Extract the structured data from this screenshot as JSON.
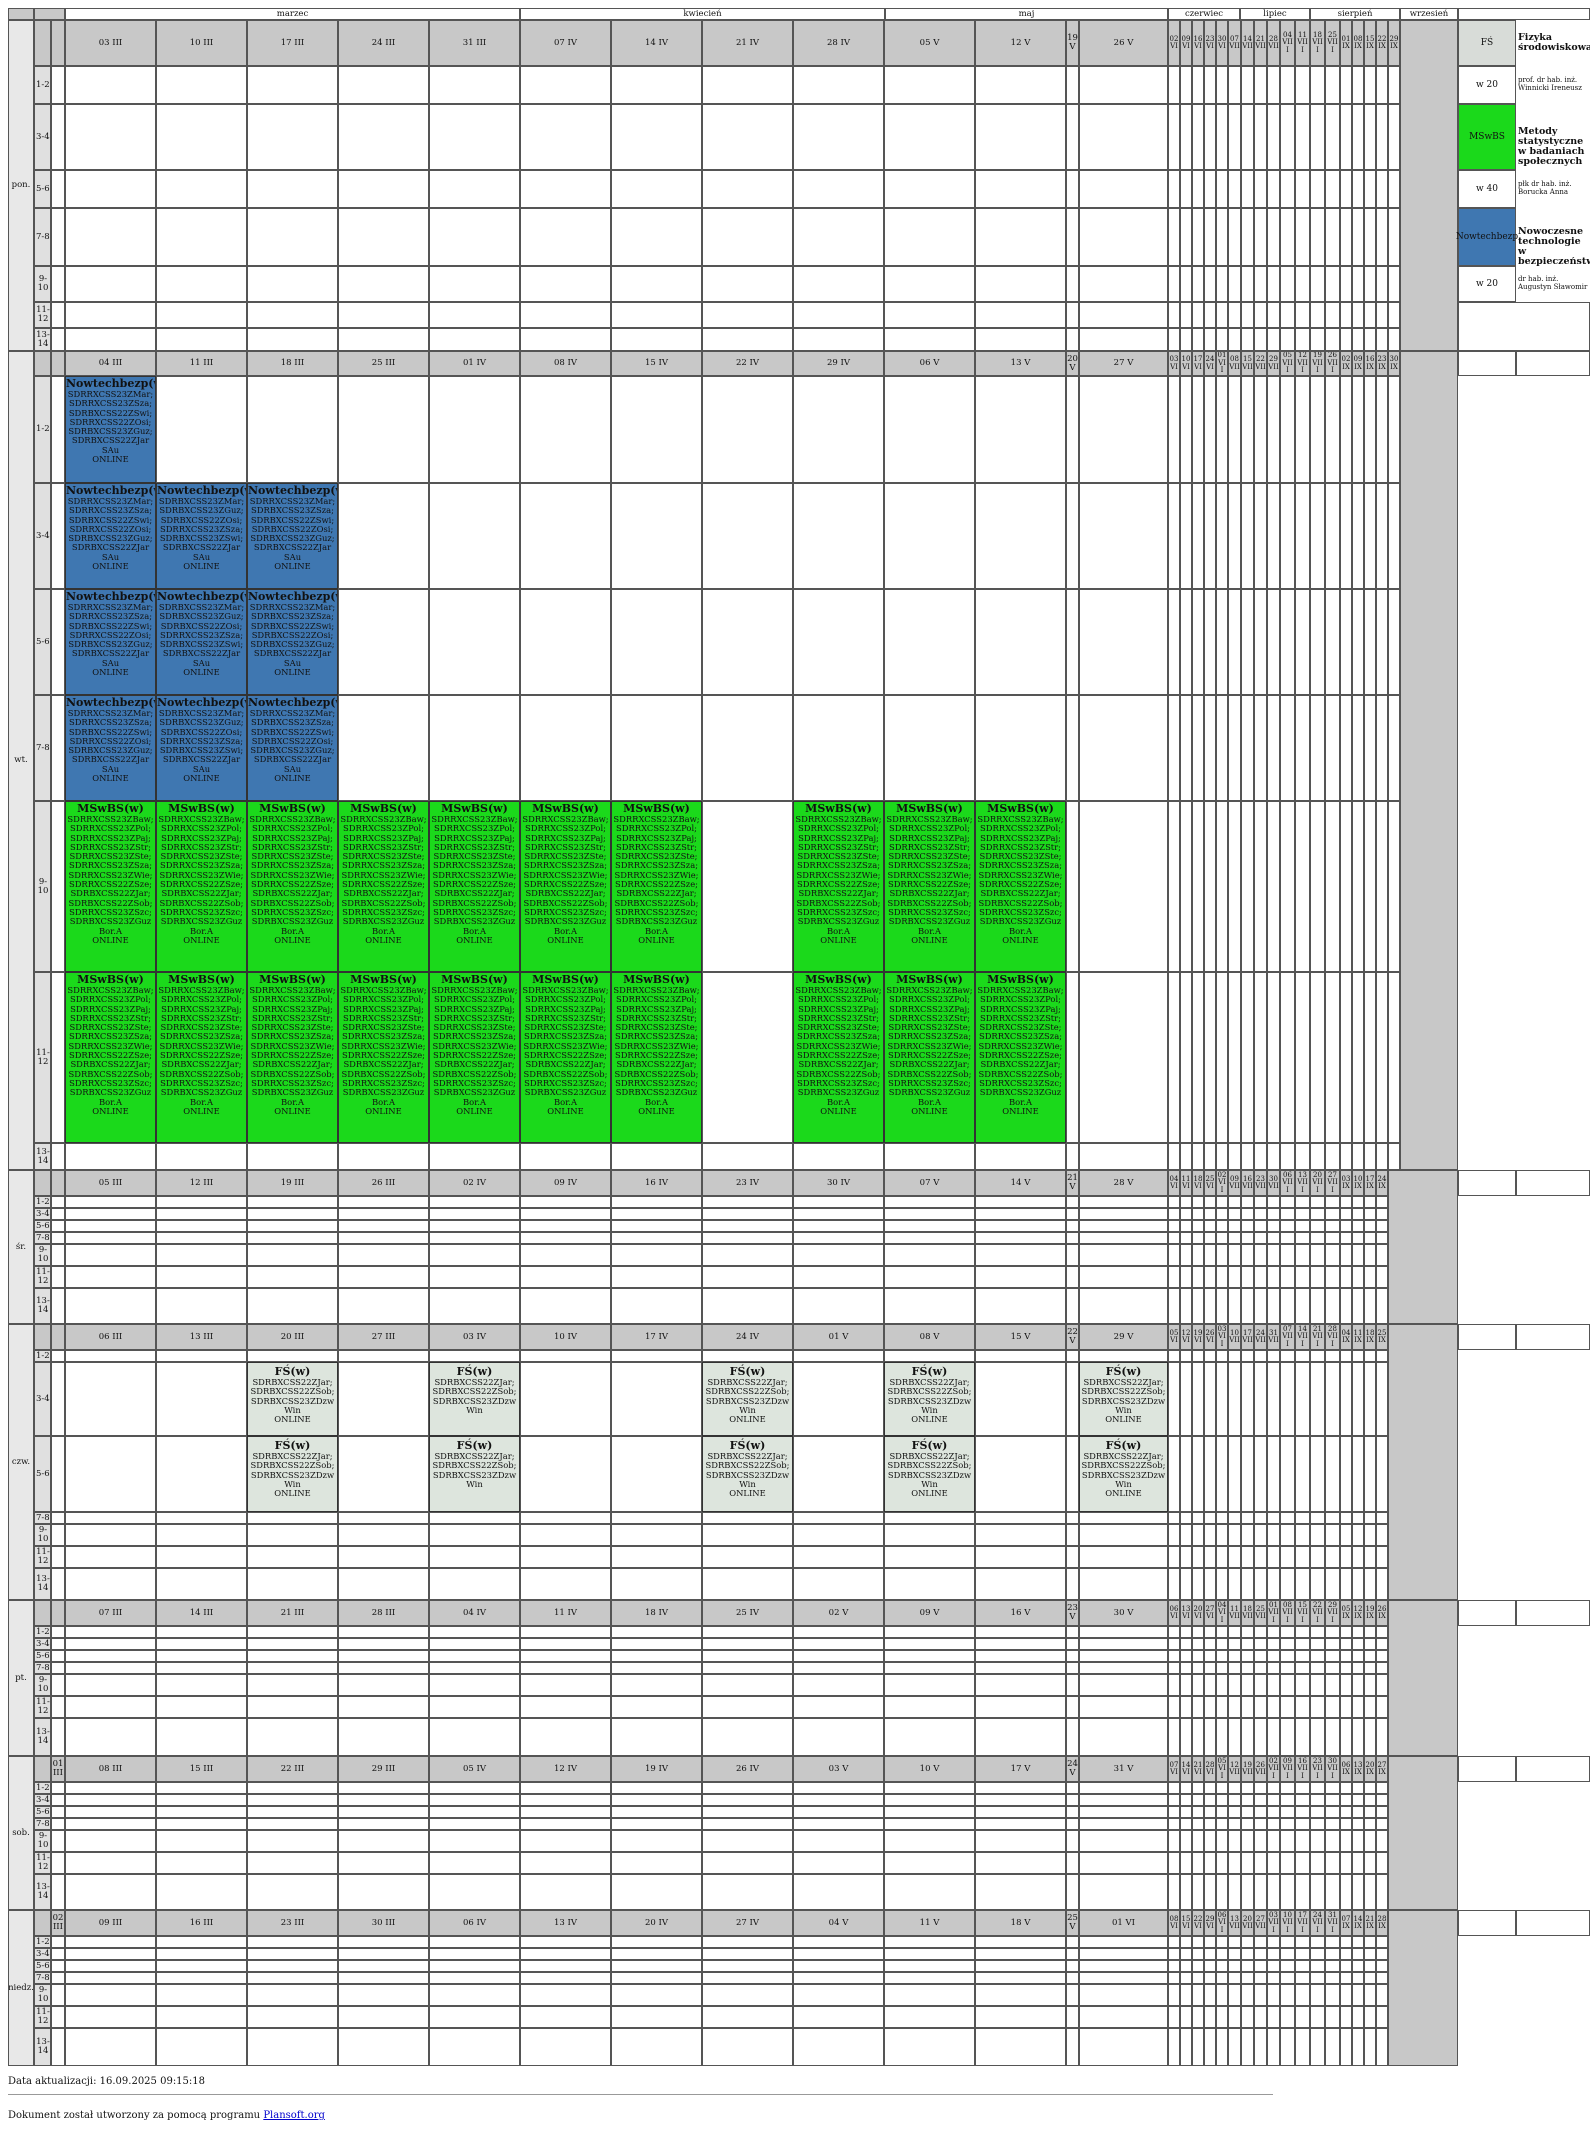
{
  "months": [
    "marzec",
    "kwiecień",
    "maj",
    "czerwiec",
    "lipiec",
    "sierpień",
    "wrzesień"
  ],
  "days": [
    {
      "label": "pon.",
      "extra": null,
      "main": [
        "03 III",
        "10 III",
        "17 III",
        "24 III",
        "31 III",
        "07 IV",
        "14 IV",
        "21 IV",
        "28 IV",
        "05 V",
        "12 V",
        "19 V",
        "26 V"
      ],
      "narrow": [
        "02 VI",
        "09 VI",
        "16 VI",
        "23 VI",
        "30 VI",
        "07 VII",
        "14 VII",
        "21 VII",
        "28 VII",
        "04 VIII",
        "11 VIII",
        "18 VIII",
        "25 VIII",
        "01 IX",
        "08 IX",
        "15 IX",
        "22 IX",
        "29 IX"
      ]
    },
    {
      "label": "wt.",
      "extra": null,
      "main": [
        "04 III",
        "11 III",
        "18 III",
        "25 III",
        "01 IV",
        "08 IV",
        "15 IV",
        "22 IV",
        "29 IV",
        "06 V",
        "13 V",
        "20 V",
        "27 V"
      ],
      "narrow": [
        "03 VI",
        "10 VI",
        "17 VI",
        "24 VI",
        "01 VII",
        "08 VII",
        "15 VII",
        "22 VII",
        "29 VII",
        "05 VIII",
        "12 VIII",
        "19 VIII",
        "26 VIII",
        "02 IX",
        "09 IX",
        "16 IX",
        "23 IX",
        "30 IX"
      ]
    },
    {
      "label": "śr.",
      "extra": null,
      "main": [
        "05 III",
        "12 III",
        "19 III",
        "26 III",
        "02 IV",
        "09 IV",
        "16 IV",
        "23 IV",
        "30 IV",
        "07 V",
        "14 V",
        "21 V",
        "28 V"
      ],
      "narrow": [
        "04 VI",
        "11 VI",
        "18 VI",
        "25 VI",
        "02 VII",
        "09 VII",
        "16 VII",
        "23 VII",
        "30 VII",
        "06 VIII",
        "13 VIII",
        "20 VIII",
        "27 VIII",
        "03 IX",
        "10 IX",
        "17 IX",
        "24 IX"
      ]
    },
    {
      "label": "czw.",
      "extra": null,
      "main": [
        "06 III",
        "13 III",
        "20 III",
        "27 III",
        "03 IV",
        "10 IV",
        "17 IV",
        "24 IV",
        "01 V",
        "08 V",
        "15 V",
        "22 V",
        "29 V"
      ],
      "narrow": [
        "05 VI",
        "12 VI",
        "19 VI",
        "26 VI",
        "03 VII",
        "10 VII",
        "17 VII",
        "24 VII",
        "31 VII",
        "07 VIII",
        "14 VIII",
        "21 VIII",
        "28 VIII",
        "04 IX",
        "11 IX",
        "18 IX",
        "25 IX"
      ]
    },
    {
      "label": "pt.",
      "extra": null,
      "main": [
        "07 III",
        "14 III",
        "21 III",
        "28 III",
        "04 IV",
        "11 IV",
        "18 IV",
        "25 IV",
        "02 V",
        "09 V",
        "16 V",
        "23 V",
        "30 V"
      ],
      "narrow": [
        "06 VI",
        "13 VI",
        "20 VI",
        "27 VI",
        "04 VII",
        "11 VII",
        "18 VII",
        "25 VII",
        "01 VIII",
        "08 VIII",
        "15 VIII",
        "22 VIII",
        "29 VIII",
        "05 IX",
        "12 IX",
        "19 IX",
        "26 IX"
      ]
    },
    {
      "label": "sob.",
      "extra": "01 III",
      "main": [
        "08 III",
        "15 III",
        "22 III",
        "29 III",
        "05 IV",
        "12 IV",
        "19 IV",
        "26 IV",
        "03 V",
        "10 V",
        "17 V",
        "24 V",
        "31 V"
      ],
      "narrow": [
        "07 VI",
        "14 VI",
        "21 VI",
        "28 VI",
        "05 VII",
        "12 VII",
        "19 VII",
        "26 VII",
        "02 VIII",
        "09 VIII",
        "16 VIII",
        "23 VIII",
        "30 VIII",
        "06 IX",
        "13 IX",
        "20 IX",
        "27 IX"
      ]
    },
    {
      "label": "niedz.",
      "extra": "02 III",
      "main": [
        "09 III",
        "16 III",
        "23 III",
        "30 III",
        "06 IV",
        "13 IV",
        "20 IV",
        "27 IV",
        "04 V",
        "11 V",
        "18 V",
        "25 V",
        "01 VI"
      ],
      "narrow": [
        "08 VI",
        "15 VI",
        "22 VI",
        "29 VI",
        "06 VII",
        "13 VII",
        "20 VII",
        "27 VII",
        "03 VIII",
        "10 VIII",
        "17 VIII",
        "24 VIII",
        "31 VIII",
        "07 IX",
        "14 IX",
        "21 IX",
        "28 IX"
      ]
    }
  ],
  "slots": [
    "1-2",
    "3-4",
    "5-6",
    "7-8",
    "9-10",
    "11-12",
    "13-14"
  ],
  "events": {
    "nowtech": {
      "title": "Nowtechbezp(w)",
      "color": "#3f77b1",
      "variants": {
        "a": [
          "SDRRXCSS23ZMar;",
          "SDRRXCSS23ZSza;",
          "SDRBXCSS22ZSwi;",
          "SDRRXCSS22ZOsi;",
          "SDRBXCSS23ZGuz;",
          "SDRBXCSS22ZJar",
          "SAu",
          "ONLINE"
        ],
        "b": [
          "SDRBXCSS23ZMar;",
          "SDRBXCSS23ZGuz;",
          "SDRBXCSS22ZOsi;",
          "SDRRXCSS23ZSza;",
          "SDRBXCSS23ZSwi;",
          "SDRBXCSS22ZJar",
          "SAu",
          "ONLINE"
        ],
        "c": [
          "SDRRXCSS23ZMar;",
          "SDRBXCSS23ZSza;",
          "SDRBXCSS22ZSwi;",
          "SDRBXCSS22ZOsi;",
          "SDRBXCSS23ZGuz;",
          "SDRBXCSS22ZJar",
          "SAu",
          "ONLINE"
        ]
      }
    },
    "mswbs": {
      "title": "MSwBS(w)",
      "color": "#1bd91b",
      "lines": [
        "SDRRXCSS23ZBaw;",
        "SDRRXCSS23ZPol;",
        "SDRRXCSS23ZPaj;",
        "SDRRXCSS23ZStr;",
        "SDRRXCSS23ZSte;",
        "SDRRXCSS23ZSza;",
        "SDRRXCSS23ZWie;",
        "SDRRXCSS22ZSze;",
        "SDRBXCSS22ZJar;",
        "SDRBXCSS22ZSob;",
        "SDRRXCSS23ZSzc;",
        "SDRBXCSS23ZGuz",
        "Bor.A",
        "ONLINE"
      ]
    },
    "fs": {
      "title": "FŚ(w)",
      "color": "#dde5dd",
      "full": [
        "SDRBXCSS22ZJar;",
        "SDRBXCSS22ZSob;",
        "SDRBXCSS23ZDzw",
        "Win",
        "ONLINE"
      ],
      "short": [
        "SDRBXCSS22ZJar;",
        "SDRBXCSS22ZSob;",
        "SDRBXCSS23ZDzw",
        "Win"
      ]
    }
  },
  "legend": [
    {
      "code": "FŚ",
      "name": "Fizyka środowiskowa",
      "color": "#d8dcd8",
      "hours": "w 20",
      "lecturer": "prof. dr hab. inż. Winnicki Ireneusz"
    },
    {
      "code": "MSwBS",
      "name": "Metody statystyczne w badaniach społecznych",
      "color": "#1bd91b",
      "hours": "w 40",
      "lecturer": "płk dr hab. inż. Borucka Anna"
    },
    {
      "code": "Nowtechbezp",
      "name": "Nowoczesne technologie w bezpieczeństwie",
      "color": "#3f77b1",
      "hours": "w 20",
      "lecturer": "dr hab. inż. Augustyn Sławomir"
    }
  ],
  "footer": {
    "date": "Data aktualizacji: 16.09.2025 09:15:18",
    "doc_prefix": "Dokument został utworzony za pomocą programu ",
    "doc_link": "Plansoft.org"
  }
}
